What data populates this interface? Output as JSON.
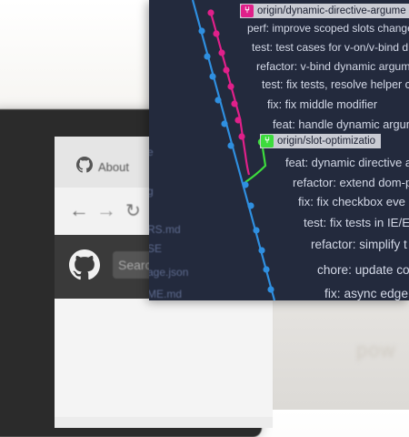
{
  "browser": {
    "tab_title": "About",
    "search_placeholder": "Search"
  },
  "colors": {
    "panel_bg": "#232a3d",
    "main_branch": "#2f8fe0",
    "feature_branch": "#e0208a",
    "slot_branch": "#3ddc3d",
    "text": "#d3d8e6"
  },
  "git": {
    "branches": [
      {
        "name": "origin/dynamic-directive-argume",
        "color": "#e0208a",
        "icon": "branch-icon"
      },
      {
        "name": "origin/slot-optimizatio",
        "color": "#3ddc3d",
        "icon": "branch-icon"
      }
    ],
    "commits": [
      "perf: improve scoped slots change",
      "test: test cases for v-on/v-bind d",
      "refactor: v-bind dynamic argum",
      "test: fix tests, resolve helper co",
      "fix: fix middle modifier",
      "feat: handle dynamic argum",
      "feat: dynamic directive a",
      "refactor: extend dom-p",
      "fix: fix checkbox eve",
      "test: fix tests in IE/E",
      "refactor: simplify t",
      "chore: update co",
      "fix: async edge"
    ],
    "side_files": [
      "e",
      "g",
      "RS.md",
      "SE",
      "age.json",
      "ME.md"
    ]
  },
  "background": {
    "stand_text": "pow"
  }
}
